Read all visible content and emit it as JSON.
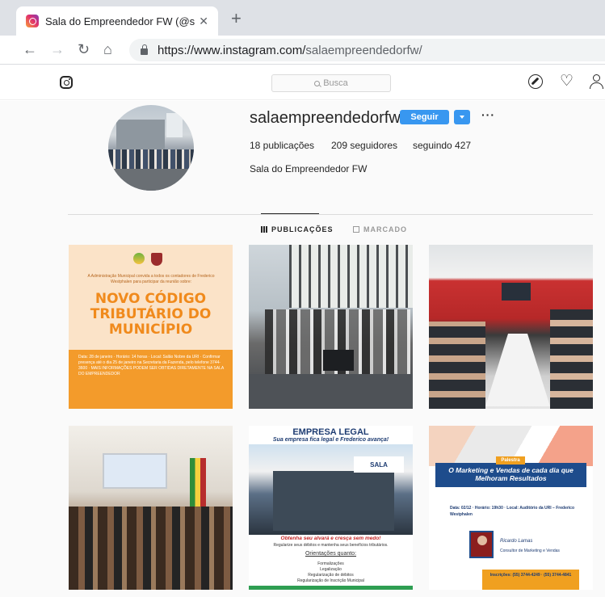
{
  "browser": {
    "tab_title": "Sala do Empreendedor FW (@sal",
    "tab_close": "✕",
    "new_tab": "+",
    "url_base": "https://www.instagram.com/",
    "url_path": "salaempreendedorfw/"
  },
  "header": {
    "search_placeholder": "Busca"
  },
  "profile": {
    "username": "salaempreendedorfw",
    "follow_label": "Seguir",
    "more": "···",
    "posts": "18 publicações",
    "followers": "209 seguidores",
    "following": "seguindo 427",
    "full_name": "Sala do Empreendedor FW"
  },
  "tabs": {
    "posts": "PUBLICAÇÕES",
    "tagged": "MARCADO"
  },
  "posts": {
    "p1": {
      "intro": "A Administração Municipal convida a todos os contadores de Frederico Westphalen para participar da reunião sobre:",
      "headline": "NOVO CÓDIGO TRIBUTÁRIO DO MUNICÍPIO",
      "details": "Data: 28 de janeiro · Horário: 14 horas · Local: Salão Nobre da URI · Confirmar presença até o dia 25 de janeiro na Secretaria da Fazenda, pelo telefone 3744-3600 · MAIS INFORMAÇÕES PODEM SER OBTIDAS DIRETAMENTE NA SALA DO EMPREENDEDOR"
    },
    "p5": {
      "title": "EMPRESA LEGAL",
      "subtitle": "Sua empresa fica legal e Frederico avança!",
      "sign": "SALA",
      "slogan": "Obtenha seu alvará e cresça sem medo!",
      "slogan_sub": "Regularize seus débitos e mantenha seus benefícios tributários.",
      "orient": "Orientações quanto:",
      "items": [
        "Formalizações",
        "Legalização",
        "Regularização de débitos",
        "Regularização de Inscrição Municipal"
      ]
    },
    "p6": {
      "tag": "Palestra",
      "title": "O Marketing e Vendas de cada dia que Melhoram Resultados",
      "info": "Data: 02/12 · Horário: 19h30 · Local: Auditório da URI – Frederico Westphalen",
      "speaker_name": "Ricardo Lamas",
      "speaker_role": "Consultor de Marketing e Vendas",
      "footer": "Inscrições: (55) 3744-4249 · (55) 3744-4841"
    }
  }
}
